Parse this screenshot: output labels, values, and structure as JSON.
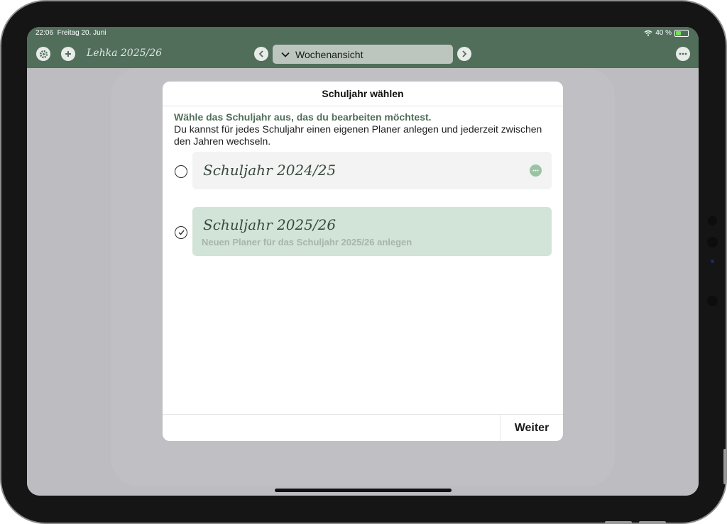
{
  "status": {
    "time": "22:06",
    "date": "Freitag 20. Juni",
    "battery": "40 %"
  },
  "toolbar": {
    "planner_name": "Lehka 2025/26",
    "view_label": "Wochenansicht",
    "icons": [
      "gear-icon",
      "plus-icon",
      "chevron-left-icon",
      "chevron-down-icon",
      "chevron-right-icon",
      "ellipsis-icon"
    ]
  },
  "dialog": {
    "title": "Schuljahr wählen",
    "heading": "Wähle das Schuljahr aus, das du bearbeiten möchtest.",
    "description": "Du kannst für jedes Schuljahr einen eigenen Planer anlegen und jederzeit zwischen den Jahren wechseln.",
    "options": [
      {
        "label": "Schuljahr 2024/25",
        "subtitle": "",
        "selected": false
      },
      {
        "label": "Schuljahr 2025/26",
        "subtitle": "Neuen Planer für das Schuljahr 2025/26 anlegen",
        "selected": true
      }
    ],
    "continue_label": "Weiter"
  },
  "colors": {
    "accent": "#516e5b",
    "selected_card": "#d2e3d8",
    "dim": "#bdbcc0"
  }
}
